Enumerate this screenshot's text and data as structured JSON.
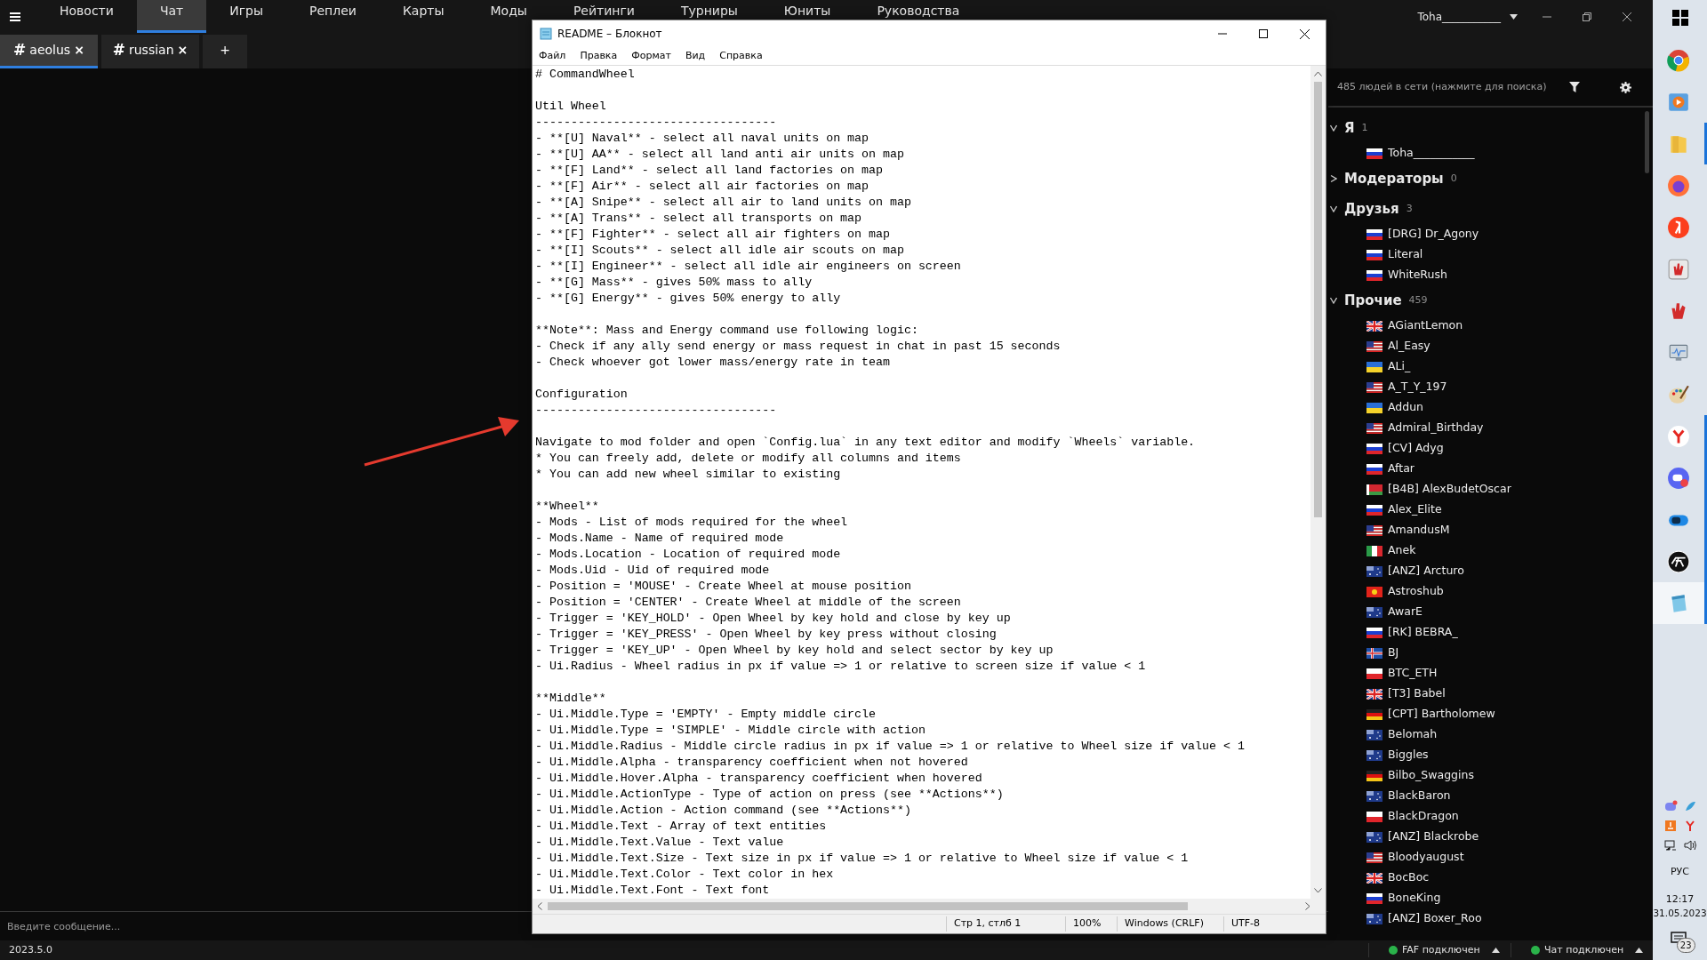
{
  "nav": {
    "items": [
      {
        "label": "Новости",
        "selected": false
      },
      {
        "label": "Чат",
        "selected": true
      },
      {
        "label": "Игры",
        "selected": false
      },
      {
        "label": "Реплеи",
        "selected": false
      },
      {
        "label": "Карты",
        "selected": false
      },
      {
        "label": "Моды",
        "selected": false
      },
      {
        "label": "Рейтинги",
        "selected": false
      },
      {
        "label": "Турниры",
        "selected": false
      },
      {
        "label": "Юниты",
        "selected": false
      },
      {
        "label": "Руководства",
        "selected": false
      }
    ],
    "user": "Toha___________"
  },
  "chat_tabs": [
    {
      "hash": "#",
      "label": "aeolus",
      "close": "×",
      "selected": true
    },
    {
      "hash": "#",
      "label": "russian",
      "close": "×",
      "selected": false
    }
  ],
  "add_tab": "+",
  "message_input": {
    "placeholder": "Введите сообщение..."
  },
  "users": {
    "search_placeholder": "485 людей в сети (нажмите для поиска)",
    "groups": [
      {
        "name": "Я",
        "count": "1",
        "expanded": true,
        "children": [
          {
            "name": "Toha___________",
            "kind": "ru"
          }
        ]
      },
      {
        "name": "Модераторы",
        "count": "0",
        "expanded": false
      },
      {
        "name": "Друзья",
        "count": "3",
        "expanded": true,
        "children": [
          {
            "name": "[DRG] Dr_Agony",
            "kind": "ru"
          },
          {
            "name": "Literal",
            "kind": "ru"
          },
          {
            "name": "WhiteRush",
            "kind": "ru"
          }
        ]
      },
      {
        "name": "Прочие",
        "count": "459",
        "expanded": true,
        "children": [
          {
            "name": "AGiantLemon",
            "kind": "gb"
          },
          {
            "name": "Al_Easy",
            "kind": "us"
          },
          {
            "name": "ALi_",
            "kind": "ua"
          },
          {
            "name": "A_T_Y_197",
            "kind": "us"
          },
          {
            "name": "Addun",
            "kind": "ua"
          },
          {
            "name": "Admiral_Birthday",
            "kind": "us"
          },
          {
            "name": "[CV] Adyg",
            "kind": "ru"
          },
          {
            "name": "Aftar",
            "kind": "ru"
          },
          {
            "name": "[B4B] AlexBudetOscar",
            "kind": "by"
          },
          {
            "name": "Alex_Elite",
            "kind": "ru"
          },
          {
            "name": "AmandusM",
            "kind": "us"
          },
          {
            "name": "Anek",
            "kind": "it"
          },
          {
            "name": "[ANZ] Arcturo",
            "kind": "au"
          },
          {
            "name": "Astroshub",
            "kind": "kg"
          },
          {
            "name": "AwarE",
            "kind": "au"
          },
          {
            "name": "[RK] BEBRA_",
            "kind": "ru"
          },
          {
            "name": "BJ",
            "kind": "is"
          },
          {
            "name": "BTC_ETH",
            "kind": "pl"
          },
          {
            "name": "[T3] Babel",
            "kind": "gb"
          },
          {
            "name": "[CPT] Bartholomew",
            "kind": "de"
          },
          {
            "name": "Belomah",
            "kind": "au"
          },
          {
            "name": "Biggles",
            "kind": "au"
          },
          {
            "name": "Bilbo_Swaggins",
            "kind": "de"
          },
          {
            "name": "BlackBaron",
            "kind": "au"
          },
          {
            "name": "BlackDragon",
            "kind": "pl"
          },
          {
            "name": "[ANZ] Blackrobe",
            "kind": "au"
          },
          {
            "name": "Bloodyaugust",
            "kind": "us"
          },
          {
            "name": "BocBoc",
            "kind": "gb"
          },
          {
            "name": "BoneKing",
            "kind": "ru"
          },
          {
            "name": "[ANZ] Boxer_Roo",
            "kind": "au"
          }
        ]
      }
    ]
  },
  "status_bar": {
    "version": "2023.5.0",
    "connections": [
      {
        "label": "FAF подключен",
        "connected": true
      },
      {
        "label": "Чат подключен",
        "connected": true
      }
    ]
  },
  "notepad": {
    "title": "README – Блокнот",
    "menu": [
      "Файл",
      "Правка",
      "Формат",
      "Вид",
      "Справка"
    ],
    "blocks": [
      [
        "# CommandWheel"
      ],
      [
        "Util Wheel",
        "----------------------------------",
        "- **[U] Naval** - select all naval units on map",
        "- **[U] AA** - select all land anti air units on map",
        "- **[F] Land** - select all land factories on map",
        "- **[F] Air** - select all air factories on map",
        "- **[A] Snipe** - select all air to land units on map",
        "- **[A] Trans** - select all transports on map",
        "- **[F] Fighter** - select all air fighters on map",
        "- **[I] Scouts** - select all idle air scouts on map",
        "- **[I] Engineer** - select all idle air engineers on screen",
        "- **[G] Mass** - gives 50% mass to ally",
        "- **[G] Energy** - gives 50% energy to ally"
      ],
      [
        "**Note**: Mass and Energy command use following logic:",
        "- Check if any ally send energy or mass request in chat in past 15 seconds",
        "- Check whoever got lower mass/energy rate in team"
      ],
      [
        "Configuration",
        "----------------------------------"
      ],
      [
        "Navigate to mod folder and open `Config.lua` in any text editor and modify `Wheels` variable.",
        "* You can freely add, delete or modify all columns and items",
        "* You can add new wheel similar to existing"
      ],
      [
        "**Wheel**",
        "- Mods - List of mods required for the wheel",
        "- Mods.Name - Name of required mode",
        "- Mods.Location - Location of required mode",
        "- Mods.Uid - Uid of required mode",
        "- Position = 'MOUSE' - Create Wheel at mouse position",
        "- Position = 'CENTER' - Create Wheel at middle of the screen",
        "- Trigger = 'KEY_HOLD' - Open Wheel by key hold and close by key up",
        "- Trigger = 'KEY_PRESS' - Open Wheel by key press without closing",
        "- Trigger = 'KEY_UP' - Open Wheel by key hold and select sector by key up",
        "- Ui.Radius - Wheel radius in px if value => 1 or relative to screen size if value < 1"
      ],
      [
        "**Middle**",
        "- Ui.Middle.Type = 'EMPTY' - Empty middle circle",
        "- Ui.Middle.Type = 'SIMPLE' - Middle circle with action",
        "- Ui.Middle.Radius - Middle circle radius in px if value => 1 or relative to Wheel size if value < 1",
        "- Ui.Middle.Alpha - transparency coefficient when not hovered",
        "- Ui.Middle.Hover.Alpha - transparency coefficient when hovered",
        "- Ui.Middle.ActionType - Type of action on press (see **Actions**)",
        "- Ui.Middle.Action - Action command (see **Actions**)",
        "- Ui.Middle.Text - Array of text entities",
        "- Ui.Middle.Text.Value - Text value",
        "- Ui.Middle.Text.Size - Text size in px if value => 1 or relative to Wheel size if value < 1",
        "- Ui.Middle.Text.Color - Text color in hex",
        "- Ui.Middle.Text.Font - Text font"
      ]
    ],
    "status": {
      "position": "Стр 1, стлб 1",
      "zoom": "100%",
      "line_endings": "Windows (CRLF)",
      "encoding": "UTF-8"
    }
  },
  "taskbar": {
    "apps": [
      {
        "running": false,
        "selected": false
      },
      {
        "running": false,
        "selected": false
      },
      {
        "running": true,
        "selected": false
      },
      {
        "running": false,
        "selected": false
      },
      {
        "running": false,
        "selected": false
      },
      {
        "running": false,
        "selected": false
      },
      {
        "running": false,
        "selected": false
      },
      {
        "running": false,
        "selected": false
      },
      {
        "running": false,
        "selected": false
      },
      {
        "running": true,
        "selected": false
      },
      {
        "running": true,
        "selected": false
      },
      {
        "running": true,
        "selected": false
      },
      {
        "running": true,
        "selected": false
      },
      {
        "running": true,
        "selected": true
      }
    ],
    "language": "РУС",
    "time": "12:17",
    "date": "31.05.2023",
    "notifications": "23"
  }
}
